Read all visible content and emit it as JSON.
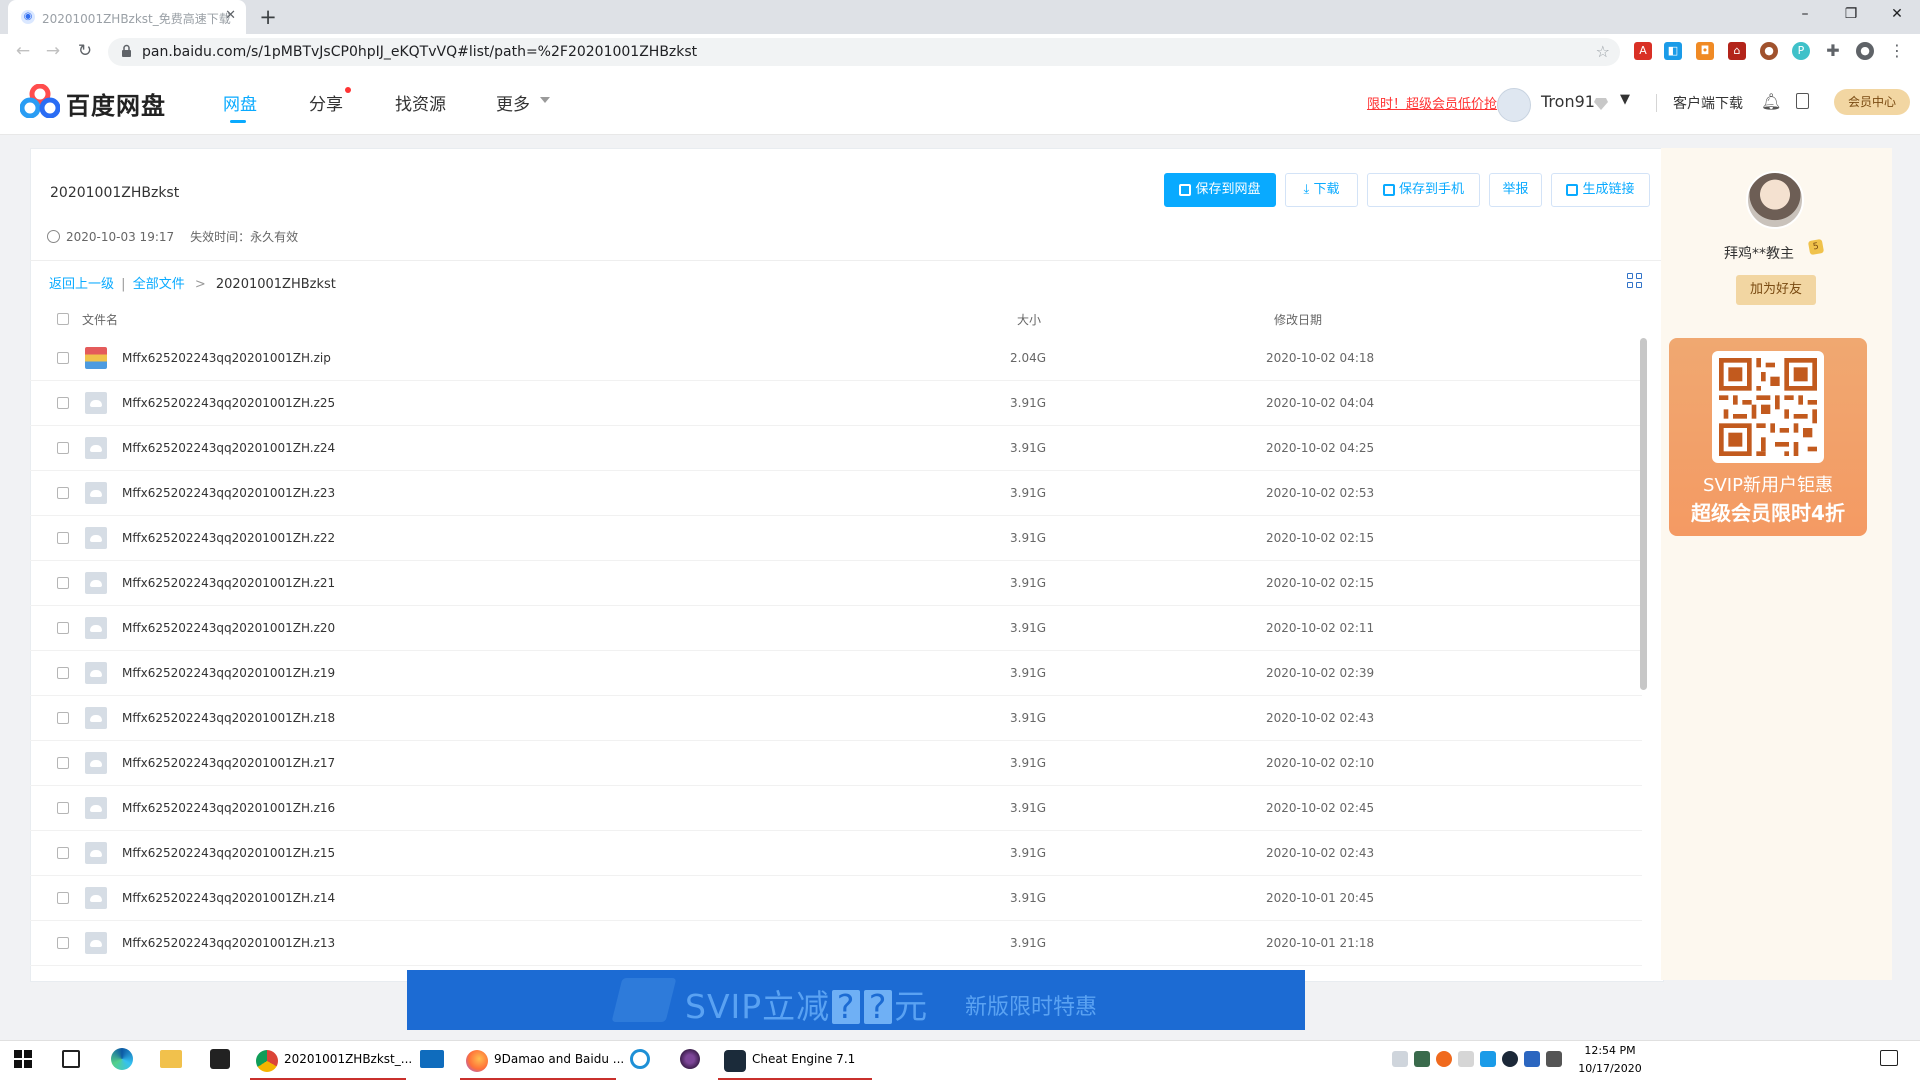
{
  "browser": {
    "tab_title": "20201001ZHBzkst_免费高速下载",
    "url": "pan.baidu.com/s/1pMBTvJsCP0hpIJ_eKQTvVQ#list/path=%2F20201001ZHBzkst",
    "window_controls": {
      "minimize": "–",
      "maximize": "❐",
      "close": "✕"
    }
  },
  "header": {
    "brand": "百度网盘",
    "nav": [
      {
        "label": "网盘",
        "active": true
      },
      {
        "label": "分享",
        "badge": true
      },
      {
        "label": "找资源"
      },
      {
        "label": "更多"
      }
    ],
    "promo": "限时！超级会员低价抢",
    "username": "Tron91",
    "client_download": "客户端下载",
    "vip_center": "会员中心"
  },
  "share": {
    "title": "20201001ZHBzkst",
    "created": "2020-10-03 19:17",
    "expiry_label": "失效时间：",
    "expiry_value": "永久有效",
    "actions": {
      "save": "保存到网盘",
      "download": "下载",
      "save_mobile": "保存到手机",
      "report": "举报",
      "link": "生成链接"
    }
  },
  "breadcrumb": {
    "back": "返回上一级",
    "sep": "|",
    "all": "全部文件",
    "arrow": ">",
    "current": "20201001ZHBzkst"
  },
  "columns": {
    "name": "文件名",
    "size": "大小",
    "date": "修改日期"
  },
  "files": [
    {
      "name": "Mffx625202243qq20201001ZH.zip",
      "size": "2.04G",
      "date": "2020-10-02 04:18",
      "type": "zip"
    },
    {
      "name": "Mffx625202243qq20201001ZH.z25",
      "size": "3.91G",
      "date": "2020-10-02 04:04",
      "type": "file"
    },
    {
      "name": "Mffx625202243qq20201001ZH.z24",
      "size": "3.91G",
      "date": "2020-10-02 04:25",
      "type": "file"
    },
    {
      "name": "Mffx625202243qq20201001ZH.z23",
      "size": "3.91G",
      "date": "2020-10-02 02:53",
      "type": "file"
    },
    {
      "name": "Mffx625202243qq20201001ZH.z22",
      "size": "3.91G",
      "date": "2020-10-02 02:15",
      "type": "file"
    },
    {
      "name": "Mffx625202243qq20201001ZH.z21",
      "size": "3.91G",
      "date": "2020-10-02 02:15",
      "type": "file"
    },
    {
      "name": "Mffx625202243qq20201001ZH.z20",
      "size": "3.91G",
      "date": "2020-10-02 02:11",
      "type": "file"
    },
    {
      "name": "Mffx625202243qq20201001ZH.z19",
      "size": "3.91G",
      "date": "2020-10-02 02:39",
      "type": "file"
    },
    {
      "name": "Mffx625202243qq20201001ZH.z18",
      "size": "3.91G",
      "date": "2020-10-02 02:43",
      "type": "file"
    },
    {
      "name": "Mffx625202243qq20201001ZH.z17",
      "size": "3.91G",
      "date": "2020-10-02 02:10",
      "type": "file"
    },
    {
      "name": "Mffx625202243qq20201001ZH.z16",
      "size": "3.91G",
      "date": "2020-10-02 02:45",
      "type": "file"
    },
    {
      "name": "Mffx625202243qq20201001ZH.z15",
      "size": "3.91G",
      "date": "2020-10-02 02:43",
      "type": "file"
    },
    {
      "name": "Mffx625202243qq20201001ZH.z14",
      "size": "3.91G",
      "date": "2020-10-01 20:45",
      "type": "file"
    },
    {
      "name": "Mffx625202243qq20201001ZH.z13",
      "size": "3.91G",
      "date": "2020-10-01 21:18",
      "type": "file"
    }
  ],
  "sidebar": {
    "sharer_name": "拜鸡**教主",
    "badge": "5",
    "add_friend": "加为好友",
    "ad_line1": "SVIP新用户钜惠",
    "ad_line2": "超级会员限时4折"
  },
  "banner": {
    "prefix": "SVIP立减",
    "mark": "?",
    "suffix": "元",
    "tagline": "新版限时特惠"
  },
  "taskbar": {
    "apps": [
      {
        "label": "20201001ZHBzkst_...",
        "icon": "chrome-icon"
      },
      {
        "label": "9Damao and Baidu ...",
        "icon": "firefox-icon"
      },
      {
        "label": "Cheat Engine 7.1",
        "icon": "cheat-engine-icon"
      }
    ],
    "time": "12:54 PM",
    "date": "10/17/2020"
  },
  "colors": {
    "accent": "#09aaff",
    "vip_gold": "#f2d6a2",
    "banner_blue": "#1c6bd3",
    "ad_orange": "#f49a63"
  }
}
